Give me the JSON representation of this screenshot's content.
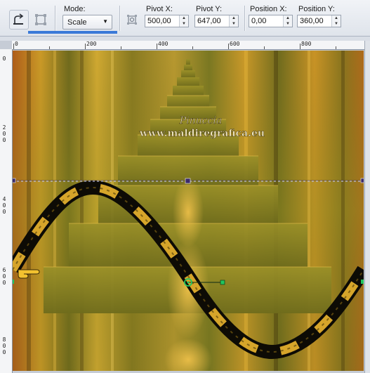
{
  "toolbar": {
    "mode_label": "Mode:",
    "mode_value": "Scale",
    "pivot_x_label": "Pivot X:",
    "pivot_x_value": "500,00",
    "pivot_y_label": "Pivot Y:",
    "pivot_y_value": "647,00",
    "position_x_label": "Position X:",
    "position_x_value": "0,00",
    "position_y_label": "Position Y:",
    "position_y_value": "360,00"
  },
  "ruler_top": [
    "0",
    "200",
    "400",
    "600",
    "800"
  ],
  "ruler_left": [
    {
      "id": "a",
      "chars": [
        "0"
      ]
    },
    {
      "id": "b",
      "chars": [
        "2",
        "0",
        "0"
      ]
    },
    {
      "id": "c",
      "chars": [
        "4",
        "0",
        "0"
      ]
    },
    {
      "id": "d",
      "chars": [
        "6",
        "0",
        "0"
      ]
    },
    {
      "id": "e",
      "chars": [
        "8",
        "0",
        "0"
      ]
    }
  ],
  "watermark": {
    "line1": "Pinuccia",
    "line2": "www.maldiregrafica.eu"
  },
  "colors": {
    "accent": "#3a79d8",
    "node": "#22c55e",
    "handle_line": "#5b3a7a"
  }
}
